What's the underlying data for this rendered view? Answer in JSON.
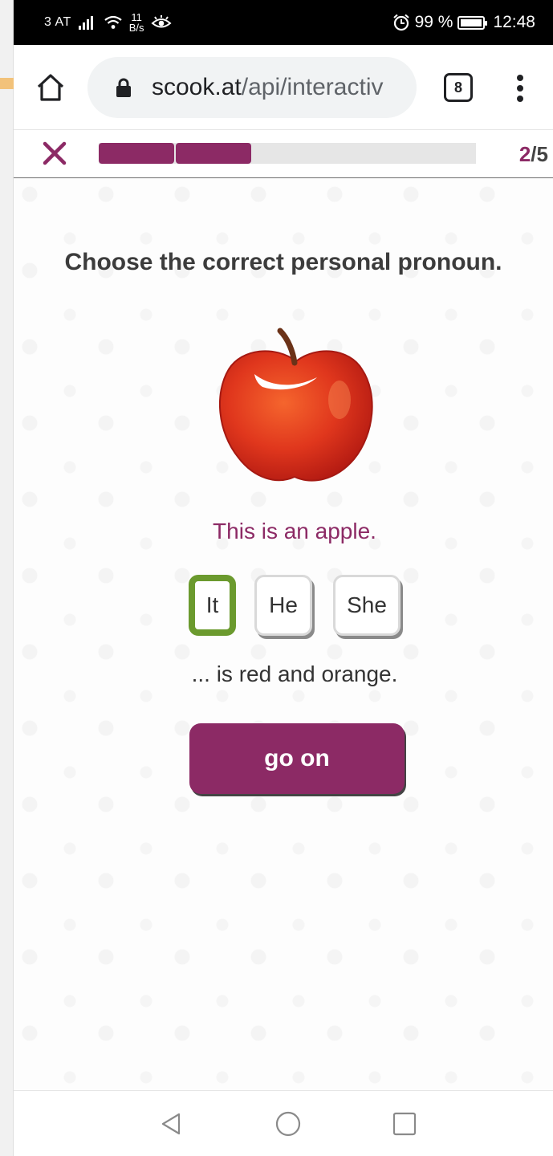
{
  "status_bar": {
    "carrier": "3 AT",
    "data_rate_value": "11",
    "data_rate_unit": "B/s",
    "battery": "99 %",
    "time": "12:48",
    "icons": [
      "signal-icon",
      "wifi-icon",
      "eye-icon",
      "alarm-icon",
      "battery-icon"
    ]
  },
  "browser": {
    "url_domain": "scook.at",
    "url_path": "/api/interactiv",
    "tab_count": "8",
    "icons": [
      "home-icon",
      "lock-icon",
      "tabs-icon",
      "overflow-menu-icon"
    ]
  },
  "quiz": {
    "progress_current": "2",
    "progress_separator": "/",
    "progress_total": "5",
    "progress_fraction": 0.4,
    "accent_color": "#8c2a65",
    "question": "Choose the correct personal pronoun.",
    "sentence": "This is an apple.",
    "options": [
      {
        "label": "It",
        "selected": true
      },
      {
        "label": "He",
        "selected": false
      },
      {
        "label": "She",
        "selected": false
      }
    ],
    "selected_color": "#6b9a2e",
    "continuation": "... is red and orange.",
    "button_label": "go on"
  },
  "nav_bar": {
    "icons": [
      "back-icon",
      "home-circle-icon",
      "recents-icon"
    ]
  }
}
